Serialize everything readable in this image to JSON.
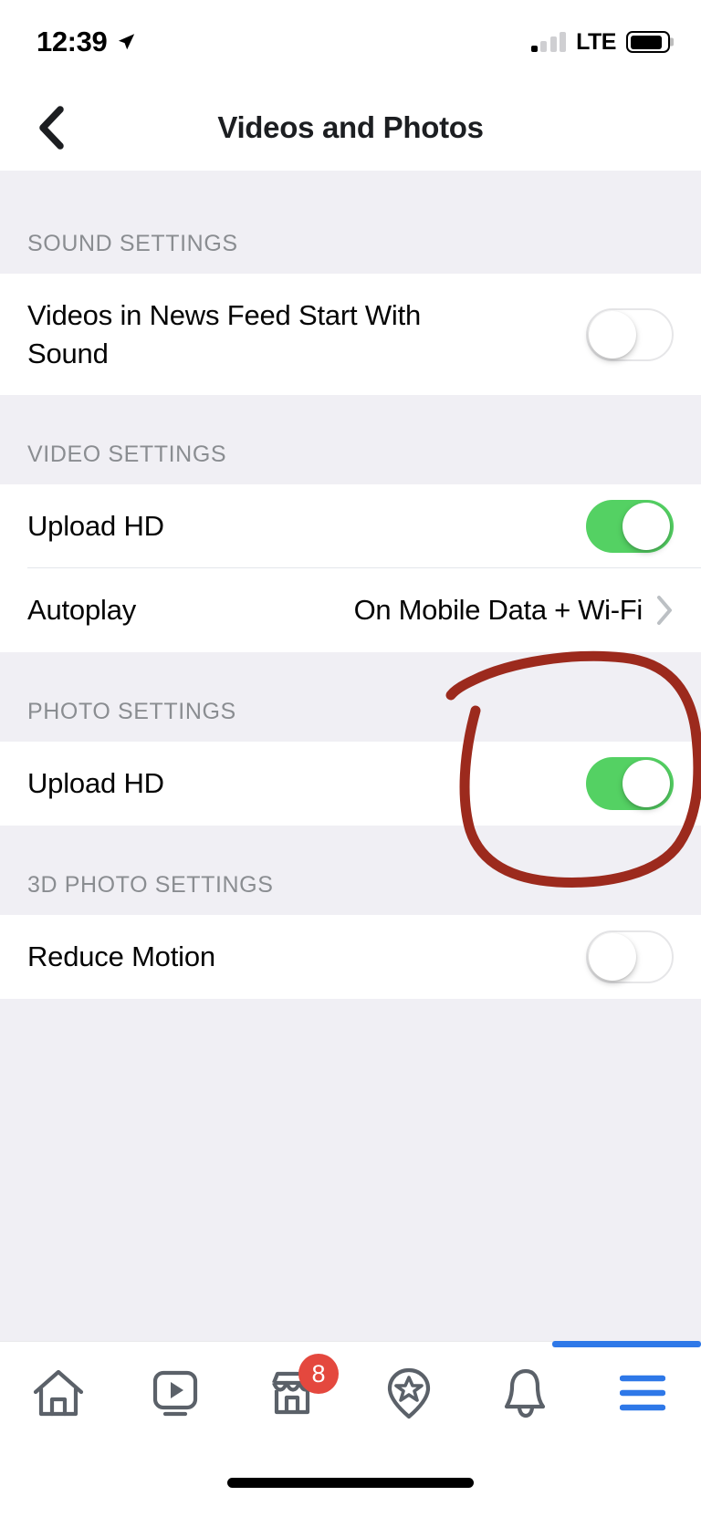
{
  "status_bar": {
    "time": "12:39",
    "location_icon": "location-arrow-icon",
    "carrier_label": "LTE",
    "signal_bars_total": 4,
    "signal_bars_active": 1,
    "battery_level_percent": 88
  },
  "nav": {
    "back_icon": "chevron-left-icon",
    "title": "Videos and Photos"
  },
  "sections": [
    {
      "id": "sound-settings",
      "header": "SOUND SETTINGS",
      "rows": [
        {
          "id": "videos-start-with-sound",
          "label": "Videos in News Feed Start With Sound",
          "control": "toggle",
          "state": "off"
        }
      ]
    },
    {
      "id": "video-settings",
      "header": "VIDEO SETTINGS",
      "rows": [
        {
          "id": "video-upload-hd",
          "label": "Upload HD",
          "control": "toggle",
          "state": "on"
        },
        {
          "id": "autoplay",
          "label": "Autoplay",
          "control": "disclosure",
          "value": "On Mobile Data + Wi-Fi"
        }
      ]
    },
    {
      "id": "photo-settings",
      "header": "PHOTO SETTINGS",
      "rows": [
        {
          "id": "photo-upload-hd",
          "label": "Upload HD",
          "control": "toggle",
          "state": "on"
        }
      ]
    },
    {
      "id": "3d-photo-settings",
      "header": "3D PHOTO SETTINGS",
      "rows": [
        {
          "id": "reduce-motion",
          "label": "Reduce Motion",
          "control": "toggle",
          "state": "off"
        }
      ]
    }
  ],
  "annotation": {
    "type": "hand-drawn-circle",
    "color": "#9c2a1d",
    "target": "photo-settings-upload-hd-toggle"
  },
  "tab_bar": {
    "active_tab": "menu",
    "active_indicator_color": "#2e78e8",
    "tabs": [
      {
        "id": "home",
        "icon": "home-icon",
        "badge": null
      },
      {
        "id": "watch",
        "icon": "watch-video-icon",
        "badge": null
      },
      {
        "id": "marketplace",
        "icon": "marketplace-store-icon",
        "badge": "8"
      },
      {
        "id": "groups",
        "icon": "location-pin-star-icon",
        "badge": null
      },
      {
        "id": "notifications",
        "icon": "bell-icon",
        "badge": null
      },
      {
        "id": "menu",
        "icon": "hamburger-menu-icon",
        "badge": null
      }
    ]
  },
  "colors": {
    "toggle_on": "#54d163",
    "badge_red": "#e4483e",
    "accent_blue": "#2e78e8",
    "section_bg": "#f0eff4",
    "row_bg": "#ffffff",
    "header_text": "#8a8d91",
    "body_text": "#050505"
  }
}
